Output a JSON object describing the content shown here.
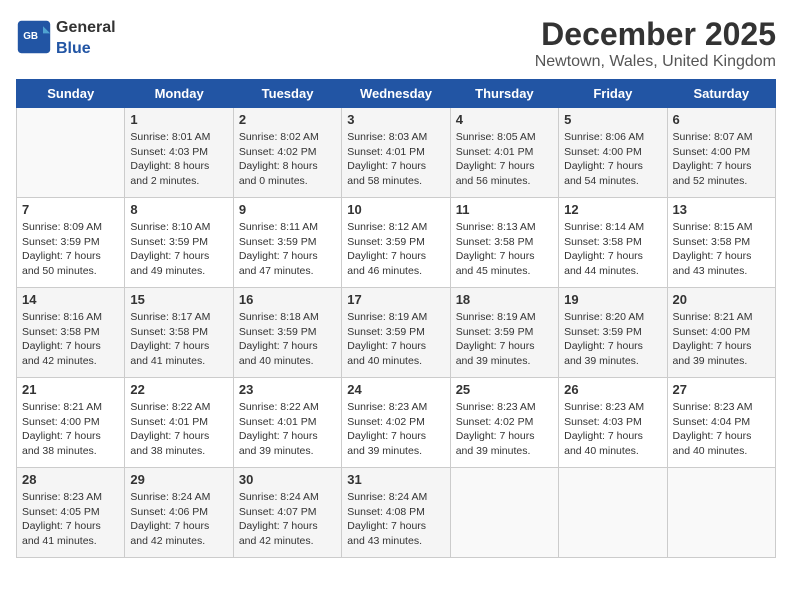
{
  "header": {
    "logo_general": "General",
    "logo_blue": "Blue",
    "month_title": "December 2025",
    "subtitle": "Newtown, Wales, United Kingdom"
  },
  "days_of_week": [
    "Sunday",
    "Monday",
    "Tuesday",
    "Wednesday",
    "Thursday",
    "Friday",
    "Saturday"
  ],
  "weeks": [
    [
      {
        "day": "",
        "sunrise": "",
        "sunset": "",
        "daylight": ""
      },
      {
        "day": "1",
        "sunrise": "Sunrise: 8:01 AM",
        "sunset": "Sunset: 4:03 PM",
        "daylight": "Daylight: 8 hours and 2 minutes."
      },
      {
        "day": "2",
        "sunrise": "Sunrise: 8:02 AM",
        "sunset": "Sunset: 4:02 PM",
        "daylight": "Daylight: 8 hours and 0 minutes."
      },
      {
        "day": "3",
        "sunrise": "Sunrise: 8:03 AM",
        "sunset": "Sunset: 4:01 PM",
        "daylight": "Daylight: 7 hours and 58 minutes."
      },
      {
        "day": "4",
        "sunrise": "Sunrise: 8:05 AM",
        "sunset": "Sunset: 4:01 PM",
        "daylight": "Daylight: 7 hours and 56 minutes."
      },
      {
        "day": "5",
        "sunrise": "Sunrise: 8:06 AM",
        "sunset": "Sunset: 4:00 PM",
        "daylight": "Daylight: 7 hours and 54 minutes."
      },
      {
        "day": "6",
        "sunrise": "Sunrise: 8:07 AM",
        "sunset": "Sunset: 4:00 PM",
        "daylight": "Daylight: 7 hours and 52 minutes."
      }
    ],
    [
      {
        "day": "7",
        "sunrise": "Sunrise: 8:09 AM",
        "sunset": "Sunset: 3:59 PM",
        "daylight": "Daylight: 7 hours and 50 minutes."
      },
      {
        "day": "8",
        "sunrise": "Sunrise: 8:10 AM",
        "sunset": "Sunset: 3:59 PM",
        "daylight": "Daylight: 7 hours and 49 minutes."
      },
      {
        "day": "9",
        "sunrise": "Sunrise: 8:11 AM",
        "sunset": "Sunset: 3:59 PM",
        "daylight": "Daylight: 7 hours and 47 minutes."
      },
      {
        "day": "10",
        "sunrise": "Sunrise: 8:12 AM",
        "sunset": "Sunset: 3:59 PM",
        "daylight": "Daylight: 7 hours and 46 minutes."
      },
      {
        "day": "11",
        "sunrise": "Sunrise: 8:13 AM",
        "sunset": "Sunset: 3:58 PM",
        "daylight": "Daylight: 7 hours and 45 minutes."
      },
      {
        "day": "12",
        "sunrise": "Sunrise: 8:14 AM",
        "sunset": "Sunset: 3:58 PM",
        "daylight": "Daylight: 7 hours and 44 minutes."
      },
      {
        "day": "13",
        "sunrise": "Sunrise: 8:15 AM",
        "sunset": "Sunset: 3:58 PM",
        "daylight": "Daylight: 7 hours and 43 minutes."
      }
    ],
    [
      {
        "day": "14",
        "sunrise": "Sunrise: 8:16 AM",
        "sunset": "Sunset: 3:58 PM",
        "daylight": "Daylight: 7 hours and 42 minutes."
      },
      {
        "day": "15",
        "sunrise": "Sunrise: 8:17 AM",
        "sunset": "Sunset: 3:58 PM",
        "daylight": "Daylight: 7 hours and 41 minutes."
      },
      {
        "day": "16",
        "sunrise": "Sunrise: 8:18 AM",
        "sunset": "Sunset: 3:59 PM",
        "daylight": "Daylight: 7 hours and 40 minutes."
      },
      {
        "day": "17",
        "sunrise": "Sunrise: 8:19 AM",
        "sunset": "Sunset: 3:59 PM",
        "daylight": "Daylight: 7 hours and 40 minutes."
      },
      {
        "day": "18",
        "sunrise": "Sunrise: 8:19 AM",
        "sunset": "Sunset: 3:59 PM",
        "daylight": "Daylight: 7 hours and 39 minutes."
      },
      {
        "day": "19",
        "sunrise": "Sunrise: 8:20 AM",
        "sunset": "Sunset: 3:59 PM",
        "daylight": "Daylight: 7 hours and 39 minutes."
      },
      {
        "day": "20",
        "sunrise": "Sunrise: 8:21 AM",
        "sunset": "Sunset: 4:00 PM",
        "daylight": "Daylight: 7 hours and 39 minutes."
      }
    ],
    [
      {
        "day": "21",
        "sunrise": "Sunrise: 8:21 AM",
        "sunset": "Sunset: 4:00 PM",
        "daylight": "Daylight: 7 hours and 38 minutes."
      },
      {
        "day": "22",
        "sunrise": "Sunrise: 8:22 AM",
        "sunset": "Sunset: 4:01 PM",
        "daylight": "Daylight: 7 hours and 38 minutes."
      },
      {
        "day": "23",
        "sunrise": "Sunrise: 8:22 AM",
        "sunset": "Sunset: 4:01 PM",
        "daylight": "Daylight: 7 hours and 39 minutes."
      },
      {
        "day": "24",
        "sunrise": "Sunrise: 8:23 AM",
        "sunset": "Sunset: 4:02 PM",
        "daylight": "Daylight: 7 hours and 39 minutes."
      },
      {
        "day": "25",
        "sunrise": "Sunrise: 8:23 AM",
        "sunset": "Sunset: 4:02 PM",
        "daylight": "Daylight: 7 hours and 39 minutes."
      },
      {
        "day": "26",
        "sunrise": "Sunrise: 8:23 AM",
        "sunset": "Sunset: 4:03 PM",
        "daylight": "Daylight: 7 hours and 40 minutes."
      },
      {
        "day": "27",
        "sunrise": "Sunrise: 8:23 AM",
        "sunset": "Sunset: 4:04 PM",
        "daylight": "Daylight: 7 hours and 40 minutes."
      }
    ],
    [
      {
        "day": "28",
        "sunrise": "Sunrise: 8:23 AM",
        "sunset": "Sunset: 4:05 PM",
        "daylight": "Daylight: 7 hours and 41 minutes."
      },
      {
        "day": "29",
        "sunrise": "Sunrise: 8:24 AM",
        "sunset": "Sunset: 4:06 PM",
        "daylight": "Daylight: 7 hours and 42 minutes."
      },
      {
        "day": "30",
        "sunrise": "Sunrise: 8:24 AM",
        "sunset": "Sunset: 4:07 PM",
        "daylight": "Daylight: 7 hours and 42 minutes."
      },
      {
        "day": "31",
        "sunrise": "Sunrise: 8:24 AM",
        "sunset": "Sunset: 4:08 PM",
        "daylight": "Daylight: 7 hours and 43 minutes."
      },
      {
        "day": "",
        "sunrise": "",
        "sunset": "",
        "daylight": ""
      },
      {
        "day": "",
        "sunrise": "",
        "sunset": "",
        "daylight": ""
      },
      {
        "day": "",
        "sunrise": "",
        "sunset": "",
        "daylight": ""
      }
    ]
  ]
}
